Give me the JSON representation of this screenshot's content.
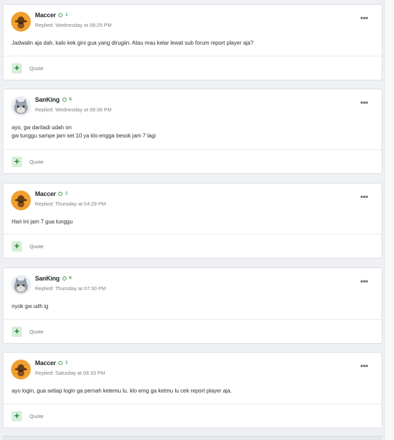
{
  "posts": [
    {
      "username": "Maccer",
      "rep": "1",
      "avatar": "orange-cowboy-avatar",
      "reply_time": "Replied: Wednesday at 08:25 PM",
      "body": [
        "Jadwalin aja dah, kalo kek gini gua yang dirugiin. Atau mau kelar lewat sub forum report player aja?"
      ],
      "action_icon": "plus-icon",
      "quote_label": "Quote"
    },
    {
      "username": "SanKing",
      "rep": "6",
      "avatar": "cat-avatar",
      "reply_time": "Replied: Wednesday at 08:36 PM",
      "body": [
        "ayo, gw daritadi udah on",
        "gw tunggu sampe jam set 10 ya klo engga besok jam 7 lagi"
      ],
      "action_icon": "plus-icon",
      "quote_label": "Quote"
    },
    {
      "username": "Maccer",
      "rep": "1",
      "avatar": "orange-cowboy-avatar",
      "reply_time": "Replied: Thursday at 04:29 PM",
      "body": [
        "Hari ini jam 7 gua tunggu"
      ],
      "action_icon": "plus-icon",
      "quote_label": "Quote"
    },
    {
      "username": "SanKing",
      "rep": "6",
      "avatar": "cat-avatar",
      "reply_time": "Replied: Thursday at 07:30 PM",
      "body": [
        "nyok gw udh ig"
      ],
      "action_icon": "plus-icon",
      "quote_label": "Quote"
    },
    {
      "username": "Maccer",
      "rep": "1",
      "avatar": "orange-cowboy-avatar",
      "reply_time": "Replied: Saturday at 08:33 PM",
      "body": [
        "ayo login, gua setiap login ga pernah ketemu lu. klo emg ga ketmu lu cek report player aja."
      ],
      "action_icon": "plus-icon",
      "quote_label": "Quote"
    }
  ],
  "menu_icon": "more-options-icon",
  "colors": {
    "online": "#3f9a4a",
    "accent_button_bg": "#d6efd9",
    "accent_button_fg": "#1e7a34",
    "muted_text": "#7b8087"
  }
}
